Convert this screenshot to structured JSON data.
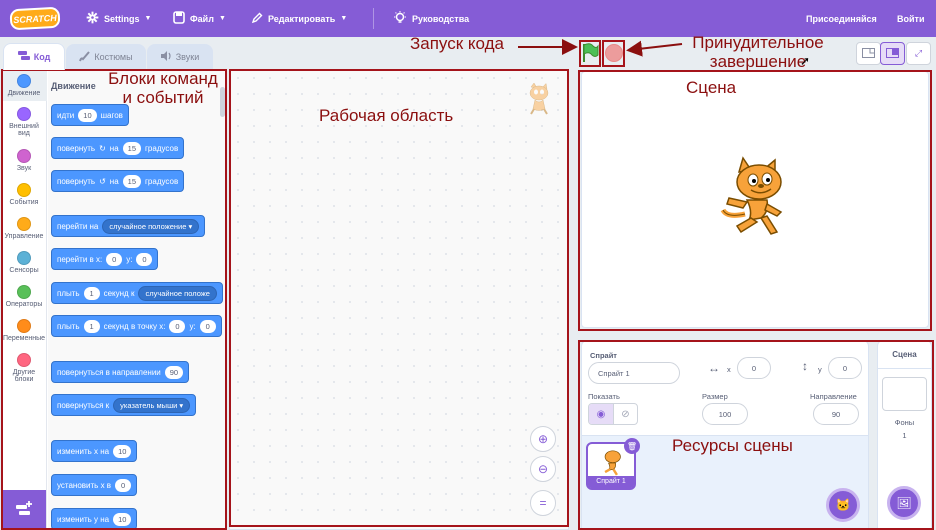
{
  "menubar": {
    "logo": "SCRATCH",
    "settings": "Settings",
    "file": "Файл",
    "edit": "Редактировать",
    "tutorials": "Руководства",
    "join": "Присоединяйся",
    "signin": "Войти"
  },
  "tabs": {
    "code": "Код",
    "costumes": "Костюмы",
    "sounds": "Звуки"
  },
  "categories": [
    {
      "label": "Движение",
      "color": "#4c97ff"
    },
    {
      "label": "Внешний вид",
      "color": "#9966ff"
    },
    {
      "label": "Звук",
      "color": "#cf63cf"
    },
    {
      "label": "События",
      "color": "#ffbf00"
    },
    {
      "label": "Управление",
      "color": "#ffab19"
    },
    {
      "label": "Сенсоры",
      "color": "#5cb1d6"
    },
    {
      "label": "Операторы",
      "color": "#59c059"
    },
    {
      "label": "Переменные",
      "color": "#ff8c1a"
    },
    {
      "label": "Другие блоки",
      "color": "#ff6680"
    }
  ],
  "palette": {
    "title": "Движение",
    "blocks": {
      "move": {
        "pre": "идти",
        "val": "10",
        "post": "шагов"
      },
      "turn_right": {
        "pre": "повернуть",
        "mid": "на",
        "val": "15",
        "post": "градусов"
      },
      "turn_left": {
        "pre": "повернуть",
        "mid": "на",
        "val": "15",
        "post": "градусов"
      },
      "goto": {
        "pre": "перейти на",
        "dd": "случайное положение"
      },
      "goto_xy": {
        "pre": "перейти в x:",
        "x": "0",
        "mid": "y:",
        "y": "0"
      },
      "glide": {
        "pre": "плыть",
        "val": "1",
        "mid": "секунд к",
        "dd": "случайное положе"
      },
      "glide_xy": {
        "pre": "плыть",
        "val": "1",
        "mid": "секунд в точку x:",
        "x": "0",
        "mid2": "y:",
        "y": "0"
      },
      "point_dir": {
        "pre": "повернуться в направлении",
        "val": "90"
      },
      "point_towards": {
        "pre": "повернуться к",
        "dd": "указатель мыши"
      },
      "change_x": {
        "pre": "изменить х на",
        "val": "10"
      },
      "set_x": {
        "pre": "установить х в",
        "val": "0"
      },
      "change_y": {
        "pre": "изменить у на",
        "val": "10"
      }
    }
  },
  "sprite_info": {
    "sprite_label": "Спрайт",
    "sprite_name": "Спрайт 1",
    "x_label": "x",
    "x_value": "0",
    "y_label": "y",
    "y_value": "0",
    "show_label": "Показать",
    "size_label": "Размер",
    "size_value": "100",
    "direction_label": "Направление",
    "direction_value": "90",
    "tile_name": "Спрайт 1"
  },
  "stage_pane": {
    "title": "Сцена",
    "backdrops_label": "Фоны",
    "backdrops_count": "1"
  },
  "annotations": {
    "run_code": "Запуск кода",
    "force_stop_1": "Принудительное",
    "force_stop_2": "завершение",
    "blocks_1": "Блоки команд",
    "blocks_2": "и событий",
    "workspace": "Рабочая область",
    "stage": "Сцена",
    "assets": "Ресурсы сцены"
  },
  "colors": {
    "accent": "#855cd6",
    "motion": "#4c97ff",
    "annotation": "#a5141b"
  }
}
